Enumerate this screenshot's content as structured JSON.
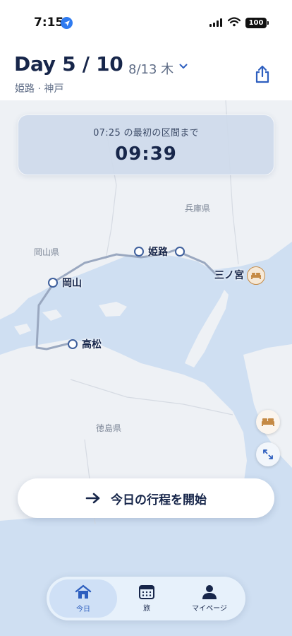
{
  "status": {
    "time": "7:15",
    "battery": "100"
  },
  "header": {
    "title": "Day 5 / 10",
    "date": "8/13 木",
    "subtitle": "姫路 · 神戸"
  },
  "countdown": {
    "label": "07:25 の最初の区間まで",
    "time": "09:39"
  },
  "map": {
    "prefectures": [
      "兵庫県",
      "岡山県",
      "徳島県"
    ],
    "cities": [
      "姫路",
      "岡山",
      "三ノ宮",
      "高松"
    ]
  },
  "actions": {
    "start_label": "今日の行程を開始"
  },
  "tabbar": {
    "tabs": [
      {
        "label": "今日",
        "icon": "home-icon",
        "active": true
      },
      {
        "label": "旅",
        "icon": "calendar-icon",
        "active": false
      },
      {
        "label": "マイページ",
        "icon": "person-icon",
        "active": false
      }
    ]
  },
  "colors": {
    "accent": "#2e5fbf",
    "navy": "#17264a",
    "hotel": "#c58a45",
    "sea": "#cfdff2",
    "land": "#eef1f5"
  }
}
